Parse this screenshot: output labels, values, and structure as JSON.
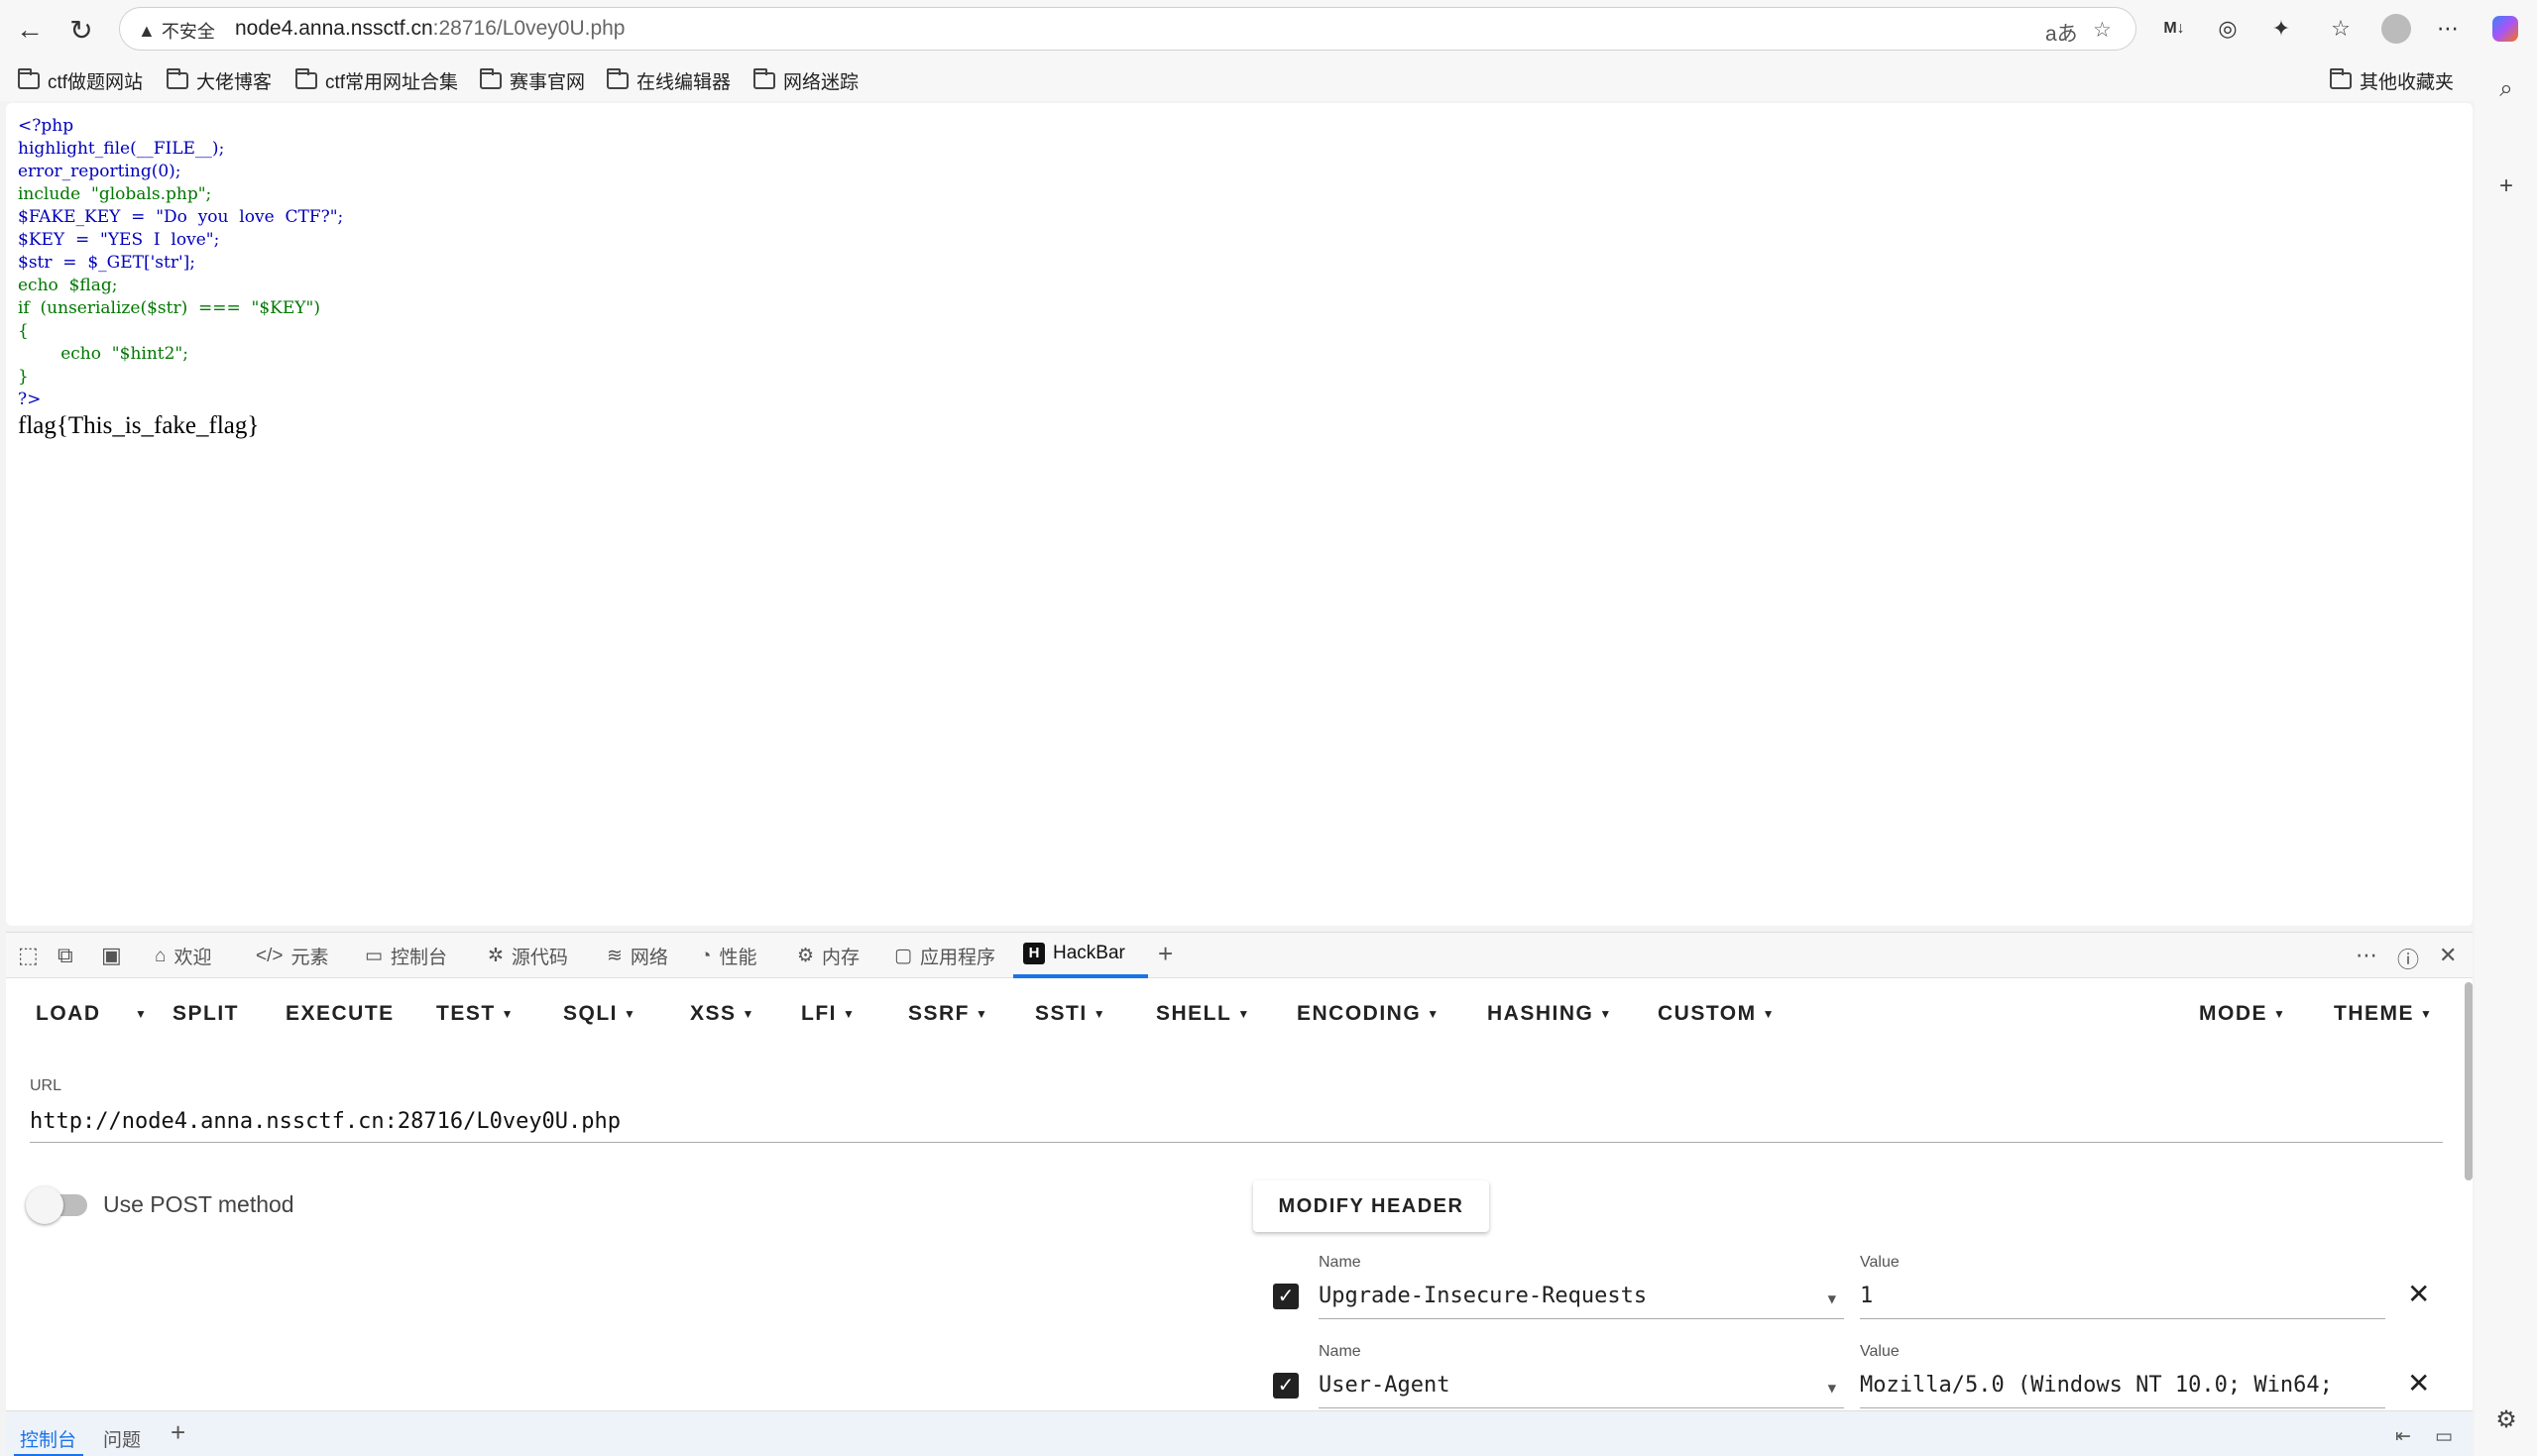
{
  "browser": {
    "security_label": "不安全",
    "url_host": "node4.anna.nssctf.cn",
    "url_rest": ":28716/L0vey0U.php",
    "translate_icon": "aあ"
  },
  "bookmarks": [
    "ctf做题网站",
    "大佬博客",
    "ctf常用网址合集",
    "赛事官网",
    "在线编辑器",
    "网络迷踪"
  ],
  "other_bookmarks": "其他收藏夹",
  "code_lines": [
    "<?php",
    "highlight_file(__FILE__);",
    "error_reporting(0);",
    "include  \"globals.php\";",
    "$FAKE_KEY  =  \"Do  you  love  CTF?\";",
    "$KEY  =  \"YES  I  love\";",
    "$str  =  $_GET['str'];",
    "echo  $flag;",
    "if  (unserialize($str)  ===  \"$KEY\")",
    "{",
    "        echo  \"$hint2\";",
    "}",
    "?>"
  ],
  "flag_output": "flag{This_is_fake_flag}",
  "devtools": {
    "tabs": [
      "欢迎",
      "元素",
      "控制台",
      "源代码",
      "网络",
      "性能",
      "内存",
      "应用程序",
      "HackBar"
    ],
    "bottom_tabs": [
      "控制台",
      "问题"
    ]
  },
  "hackbar": {
    "menu": [
      "LOAD",
      "SPLIT",
      "EXECUTE",
      "TEST",
      "SQLI",
      "XSS",
      "LFI",
      "SSRF",
      "SSTI",
      "SHELL",
      "ENCODING",
      "HASHING",
      "CUSTOM"
    ],
    "mode": "MODE",
    "theme": "THEME",
    "url_label": "URL",
    "url_value": "http://node4.anna.nssctf.cn:28716/L0vey0U.php",
    "post_label": "Use POST method",
    "modify_header": "MODIFY HEADER",
    "headers": [
      {
        "name_label": "Name",
        "name": "Upgrade-Insecure-Requests",
        "value_label": "Value",
        "value": "1"
      },
      {
        "name_label": "Name",
        "name": "User-Agent",
        "value_label": "Value",
        "value": "Mozilla/5.0 (Windows NT 10.0; Win64;"
      }
    ]
  }
}
